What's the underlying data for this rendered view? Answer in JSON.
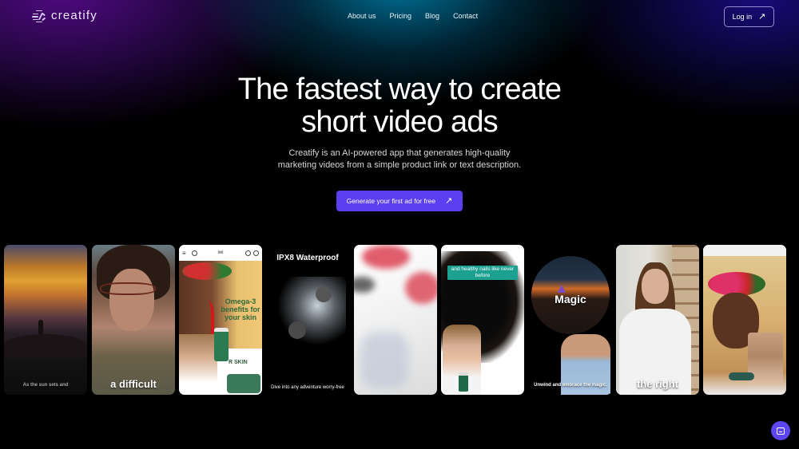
{
  "brand": {
    "name": "creatify",
    "accent": "#5b3ff0"
  },
  "nav": {
    "links": [
      "About us",
      "Pricing",
      "Blog",
      "Contact"
    ],
    "login_label": "Log in",
    "login_icon": "arrow-up-right-icon"
  },
  "hero": {
    "headline_line1": "The fastest way to create",
    "headline_line2": "short video ads",
    "subtitle_line1": "Creatify is an AI-powered app that generates high-quality",
    "subtitle_line2": "marketing videos from a simple product link or text description.",
    "cta_label": "Generate your first ad for free",
    "cta_icon": "arrow-up-right-icon"
  },
  "video_cards": [
    {
      "caption": "As the sun sets and",
      "scene": "sunset-silhouette"
    },
    {
      "caption": "a difficult",
      "scene": "woman-with-glasses"
    },
    {
      "caption": "",
      "scene": "product-webpage",
      "site_name": "iwi",
      "overlay_text": "Omega-3 benefits for your skin",
      "lower_text": "R SKIN"
    },
    {
      "caption": "Dive into any adventure worry-free",
      "scene": "waterproof-earbuds",
      "title": "IPX8 Waterproof"
    },
    {
      "caption": "",
      "scene": "motion-blur-red"
    },
    {
      "caption": "",
      "scene": "hair-silhouette",
      "overlay_text": "and healthy nails like never before"
    },
    {
      "caption": "Unwind and embrace the magic.",
      "scene": "magic-presenter",
      "title": "Magic"
    },
    {
      "caption": "the right",
      "scene": "woman-in-store"
    },
    {
      "caption": "",
      "scene": "browser-product-page"
    }
  ],
  "chat_widget": {
    "icon": "chat-icon"
  }
}
